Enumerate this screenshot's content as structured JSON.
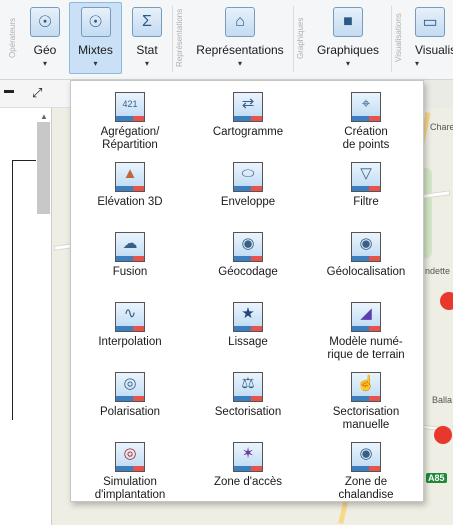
{
  "ribbon": {
    "group_operateurs": "Opérateurs",
    "group_representations": "Représentations",
    "group_graphiques": "Graphiques",
    "group_visualisations": "Visualisations",
    "buttons": {
      "geo": {
        "label": "Géo",
        "icon": "compass-icon",
        "glyph": "☉"
      },
      "mixtes": {
        "label": "Mixtes",
        "icon": "compass-sigma-icon",
        "glyph": "☉"
      },
      "stat": {
        "label": "Stat",
        "icon": "sigma-icon",
        "glyph": "Σ"
      },
      "representations": {
        "label": "Représentations",
        "icon": "map-house-icon",
        "glyph": "⌂"
      },
      "graphiques": {
        "label": "Graphiques",
        "icon": "chart-icon",
        "glyph": "■"
      },
      "visualisations": {
        "label": "Visualis",
        "icon": "monitor-icon",
        "glyph": "▭"
      }
    },
    "caret": "▾"
  },
  "map": {
    "labels": {
      "chare": "Chare",
      "ndette": "ndette",
      "balla": "Balla",
      "road_number": "A85"
    },
    "colors": {
      "dot": "#e8382e"
    }
  },
  "menu": {
    "items": [
      {
        "label": "Agrégation/\nRépartition",
        "icon": "aggregation-icon",
        "glyph": "421"
      },
      {
        "label": "Cartogramme",
        "icon": "cartogram-icon",
        "glyph": "⇄"
      },
      {
        "label": "Création\nde points",
        "icon": "point-creation-icon",
        "glyph": "⌖"
      },
      {
        "label": "Elévation 3D",
        "icon": "elevation-3d-icon",
        "glyph": "▲"
      },
      {
        "label": "Enveloppe",
        "icon": "envelope-icon",
        "glyph": "⬭"
      },
      {
        "label": "Filtre",
        "icon": "filter-icon",
        "glyph": "▽"
      },
      {
        "label": "Fusion",
        "icon": "fusion-icon",
        "glyph": "☁"
      },
      {
        "label": "Géocodage",
        "icon": "geocoding-icon",
        "glyph": "◉"
      },
      {
        "label": "Géolocalisation",
        "icon": "geolocation-icon",
        "glyph": "◉"
      },
      {
        "label": "Interpolation",
        "icon": "interpolation-icon",
        "glyph": "∿"
      },
      {
        "label": "Lissage",
        "icon": "smoothing-icon",
        "glyph": "★"
      },
      {
        "label": "Modèle numé-\nrique de terrain",
        "icon": "terrain-model-icon",
        "glyph": "◢"
      },
      {
        "label": "Polarisation",
        "icon": "polarisation-icon",
        "glyph": "◎"
      },
      {
        "label": "Sectorisation",
        "icon": "sectorisation-icon",
        "glyph": "⚖"
      },
      {
        "label": "Sectorisation\nmanuelle",
        "icon": "manual-sectorisation-icon",
        "glyph": "☝"
      },
      {
        "label": "Simulation\nd'implantation",
        "icon": "implantation-simulation-icon",
        "glyph": "◎"
      },
      {
        "label": "Zone d'accès",
        "icon": "access-zone-icon",
        "glyph": "✶"
      },
      {
        "label": "Zone de\nchalandise",
        "icon": "catchment-area-icon",
        "glyph": "◉"
      }
    ]
  }
}
